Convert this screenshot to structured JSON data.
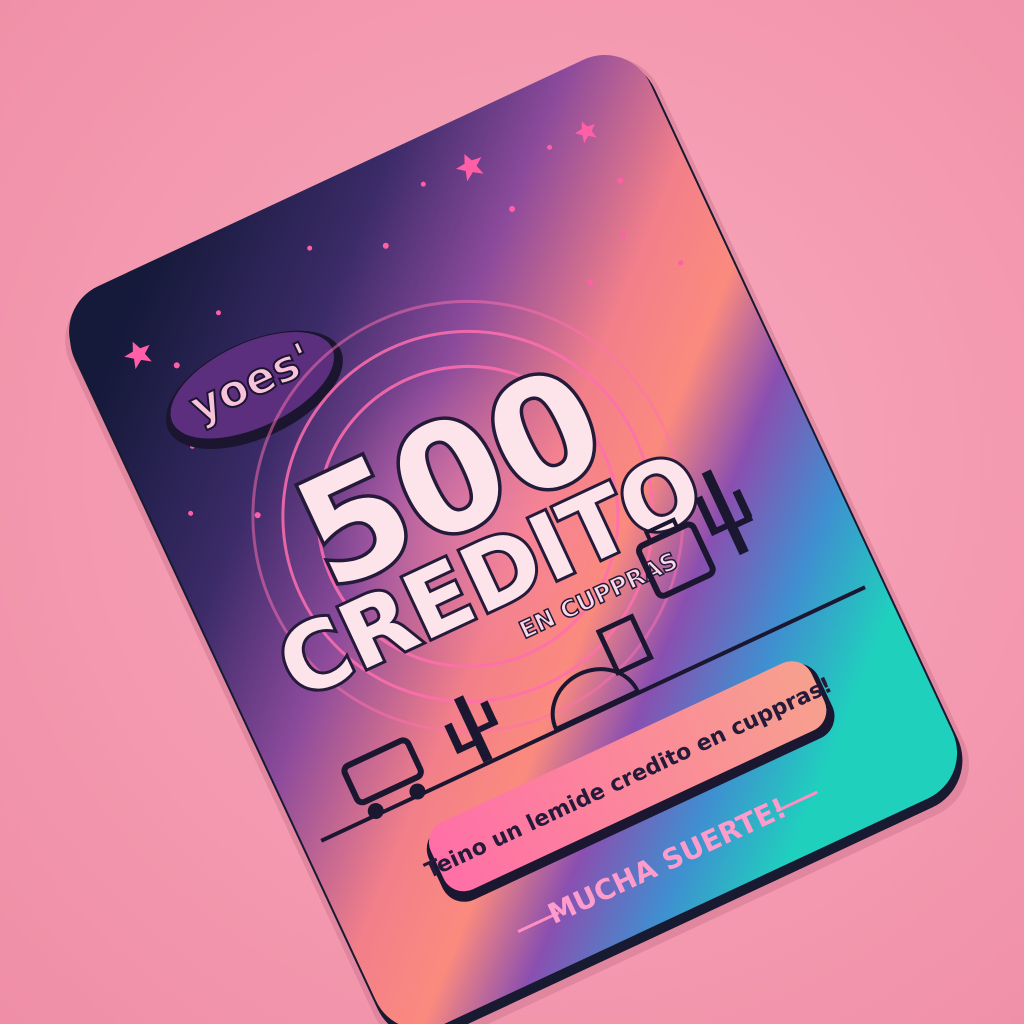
{
  "colors": {
    "background": "#f49ab0",
    "card_top": "#1d1b3d",
    "card_mid_purple": "#6b3a8f",
    "card_sunset": "#f77f86",
    "card_bottom_teal": "#23c4c4",
    "neon_pink": "#ff5c9e",
    "title_fill": "#fde3ea",
    "title_outline": "#241a3a",
    "button_fill": "#ff5fa0"
  },
  "card": {
    "brand": "yoes'",
    "amount": "500",
    "title": "CREDITO",
    "subtitle": "EN CUPPRAS",
    "button_label": "Teino un lemide credito en cuppras!",
    "footer": "MUCHA SUERTE!"
  },
  "icons": [
    "star-icon",
    "cactus-icon",
    "shopping-cart-icon",
    "luggage-icon",
    "cash-register-icon",
    "globe-icon"
  ]
}
